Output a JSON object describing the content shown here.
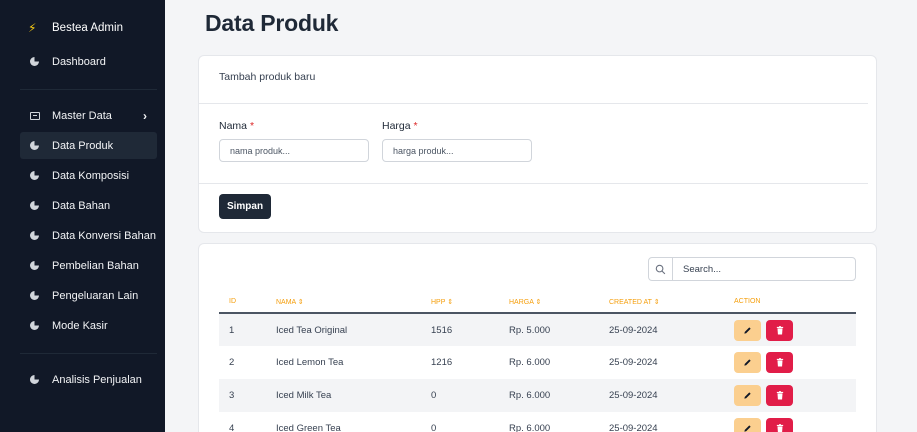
{
  "sidebar": {
    "brand": "Bestea Admin",
    "items": [
      {
        "label": "Dashboard",
        "icon": "pie-chart-icon"
      },
      {
        "label": "Master Data",
        "icon": "table-icon"
      },
      {
        "label": "Data Produk",
        "icon": "pie-chart-icon",
        "active": true
      },
      {
        "label": "Data Komposisi",
        "icon": "pie-chart-icon"
      },
      {
        "label": "Data Bahan",
        "icon": "pie-chart-icon"
      },
      {
        "label": "Data Konversi Bahan",
        "icon": "pie-chart-icon"
      },
      {
        "label": "Pembelian Bahan",
        "icon": "pie-chart-icon"
      },
      {
        "label": "Pengeluaran Lain",
        "icon": "pie-chart-icon"
      },
      {
        "label": "Mode Kasir",
        "icon": "pie-chart-icon"
      },
      {
        "label": "Analisis Penjualan",
        "icon": "pie-chart-icon"
      }
    ]
  },
  "page": {
    "title": "Data Produk"
  },
  "form": {
    "title": "Tambah produk baru",
    "nama_label": "Nama",
    "nama_placeholder": "nama produk...",
    "harga_label": "Harga",
    "harga_placeholder": "harga produk...",
    "required_mark": "*",
    "submit_label": "Simpan"
  },
  "table": {
    "search_placeholder": "Search...",
    "columns": [
      "ID",
      "NAMA ⇕",
      "HPP ⇕",
      "HARGA ⇕",
      "CREATED AT ⇕",
      "ACTION"
    ],
    "rows": [
      {
        "id": "1",
        "nama": "Iced Tea Original",
        "hpp": "1516",
        "harga": "Rp. 5.000",
        "created_at": "25-09-2024"
      },
      {
        "id": "2",
        "nama": "Iced Lemon Tea",
        "hpp": "1216",
        "harga": "Rp. 6.000",
        "created_at": "25-09-2024"
      },
      {
        "id": "3",
        "nama": "Iced Milk Tea",
        "hpp": "0",
        "harga": "Rp. 6.000",
        "created_at": "25-09-2024"
      },
      {
        "id": "4",
        "nama": "Iced Green Tea",
        "hpp": "0",
        "harga": "Rp. 6.000",
        "created_at": "25-09-2024"
      }
    ]
  },
  "colors": {
    "sidebar_bg": "#111827",
    "accent_header": "#f59e0b",
    "edit_button": "#fbcf8f",
    "delete_button": "#e11d48"
  }
}
